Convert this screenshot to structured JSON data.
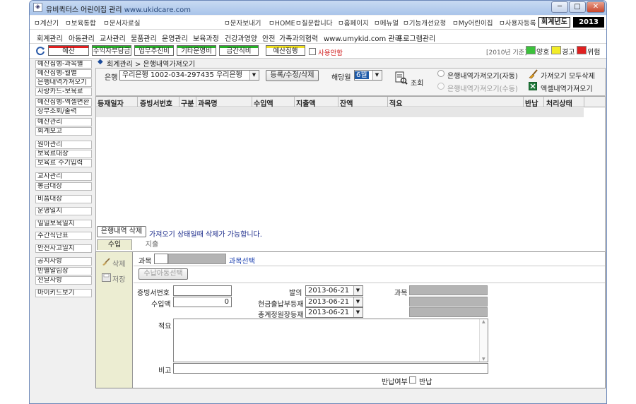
{
  "window": {
    "title": "유비퀵터스 어린이집 관리",
    "url": "www.ukidcare.com",
    "icon": "app-icon",
    "controls": {
      "minimize": "─",
      "maximize": "□",
      "close": "✕"
    }
  },
  "top_menu": {
    "items": [
      "계산기",
      "보육통합",
      "문서자료실"
    ],
    "right_items": [
      "문자보내기",
      "HOME",
      "질문합니다",
      "홈페이지",
      "메뉴얼",
      "기능개선요청",
      "My어린이집",
      "사용자등록"
    ],
    "year_label": "회계년도",
    "year_value": "2013"
  },
  "main_menu": {
    "items": [
      "회계관리",
      "아동관리",
      "교사관리",
      "물품관리",
      "운영관리",
      "보육과정",
      "건강과영양",
      "안전",
      "가족과의협력",
      "www.umykid.com 관리",
      "프로그램관리"
    ]
  },
  "toolbar": {
    "refresh_icon": "refresh-icon",
    "buttons": [
      {
        "label": "예산",
        "color": "#e02020"
      },
      {
        "label": "수익자부담금",
        "color": "#27b027"
      },
      {
        "label": "업무추진비",
        "color": "#27b027"
      },
      {
        "label": "기타운영비",
        "color": "#27b027"
      },
      {
        "label": "급간식비",
        "color": "#27b027"
      },
      {
        "label": "예산집행",
        "color": "#f0e020"
      }
    ],
    "unused_label": "사용안함",
    "year_note": "[2010년 기준]",
    "legend": [
      {
        "label": "양호",
        "color": "#3cc23c"
      },
      {
        "label": "경고",
        "color": "#f2ec28"
      },
      {
        "label": "위험",
        "color": "#e02020"
      }
    ]
  },
  "sidebar": {
    "items": [
      "예산집행-과목별",
      "예산집행-월별",
      "은행내역가져오기",
      "사랑카드-보육료",
      "예산집행-엑셀변환",
      "장부조회/출력",
      "예산관리",
      "회계보고",
      "원아관리",
      "보육료대장",
      "보육료 수기입력",
      "교사관리",
      "봉급대장",
      "비품대장",
      "운영일지",
      "일일보육일지",
      "주간식단표",
      "안전사고일지",
      "공지사항",
      "반별알림장",
      "전달사항",
      "마이키드보기"
    ]
  },
  "breadcrumb": "회계관리 > 은행내역가져오기",
  "bank_filter": {
    "bank_label": "은행",
    "bank_value": "우리은행 1002-034-297435 우리은행",
    "register_button": "등록/수정/삭제",
    "month_label": "해당월",
    "month_value": "6월",
    "search_button": "조회",
    "option_auto": "은행내역가져오기(자동)",
    "option_manual": "은행내역가져오기(수동)",
    "delete_all": "가져오기 모두삭제",
    "excel_import": "엑셀내역가져오기"
  },
  "grid": {
    "columns": [
      "등재일자",
      "증빙서번호",
      "구분",
      "과목명",
      "수입액",
      "지출액",
      "잔액",
      "적요",
      "반납",
      "처리상태"
    ]
  },
  "delete_row": {
    "button": "은행내역 삭제",
    "note": "가져오기 상태일때 삭제가 가능합니다."
  },
  "tabs": [
    "수입",
    "지출"
  ],
  "form": {
    "delete_button": "삭제",
    "save_button": "저장",
    "subject_label": "과목",
    "subject_select": "과목선택",
    "income_select_button": "수납아동선택",
    "voucher_label": "증빙서번호",
    "voucher_value": "",
    "income_label": "수입액",
    "income_value": "0",
    "issue_label": "발의",
    "issue_date": "2013-06-21",
    "cash_label": "현금출납부등재",
    "cash_date": "2013-06-21",
    "ledger_label": "총계정원장등재",
    "ledger_date": "2013-06-21",
    "subject2_label": "과목",
    "memo_label": "적요",
    "note_label": "비고",
    "return_label": "반납여부",
    "return_check": "반납"
  }
}
